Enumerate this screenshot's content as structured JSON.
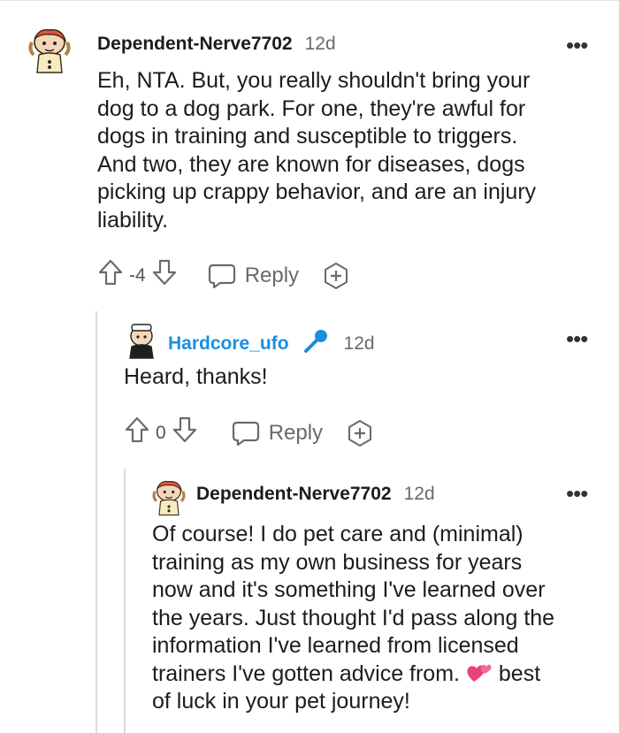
{
  "comments": [
    {
      "username": "Dependent-Nerve7702",
      "time": "12d",
      "lines": [
        "Eh, NTA. But, you really shouldn't bring your",
        "dog to a dog park. For one, they're awful for",
        "dogs in training and susceptible to triggers.",
        "And two, they are known for diseases, dogs",
        "picking up crappy behavior, and are an injury",
        "liability."
      ],
      "votes": "-4",
      "reply_label": "Reply",
      "more_label": "•••"
    },
    {
      "username": "Hardcore_ufo",
      "time": "12d",
      "lines": [
        "Heard, thanks!"
      ],
      "votes": "0",
      "reply_label": "Reply",
      "more_label": "•••",
      "badge_icon": "microphone-icon"
    },
    {
      "username": "Dependent-Nerve7702",
      "time": "12d",
      "lines": [
        "Of course! I do pet care and (minimal)",
        "training as my own business for years",
        "now and it's something I've learned over",
        "the years. Just thought I'd pass along the",
        "information I've learned from licensed",
        "trainers I've gotten advice from.",
        "of luck in your pet journey!"
      ],
      "line6_suffix": "best",
      "emoji": "two-hearts-icon",
      "more_label": "•••"
    }
  ],
  "colors": {
    "op_username": "#1a8fe0",
    "text": "#1c1c1c",
    "muted": "#6a6a6a",
    "thread_line": "#dcdcdc"
  }
}
